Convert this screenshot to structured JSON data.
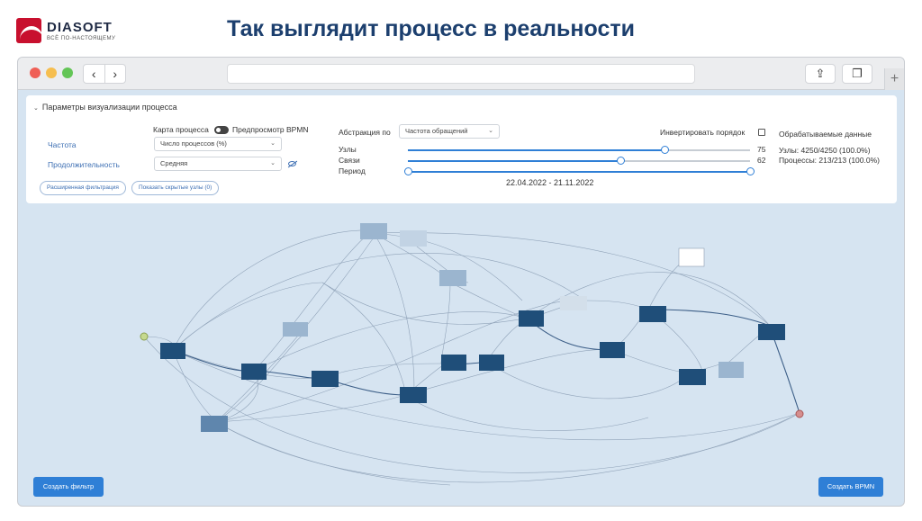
{
  "logo": {
    "name": "DIASOFT",
    "tagline": "ВСЁ ПО-НАСТОЯЩЕМУ"
  },
  "slide_title": "Так выглядит процесс в реальности",
  "browser": {
    "back_icon": "chevron-left-icon",
    "forward_icon": "chevron-right-icon",
    "share_icon": "share-icon",
    "tabs_icon": "tabs-icon",
    "new_tab_icon": "plus-icon"
  },
  "panel": {
    "title": "Параметры визуализации процесса",
    "map_label": "Карта процесса",
    "bpmn_preview_label": "Предпросмотр BPMN",
    "frequency_label": "Частота",
    "frequency_value": "Число процессов (%)",
    "duration_label": "Продолжительность",
    "duration_value": "Средняя",
    "extended_filter": "Расширенная фильтрация",
    "show_hidden_nodes": "Показать скрытые узлы (0)",
    "abstraction_label": "Абстракция по",
    "abstraction_value": "Частота обращений",
    "invert_order": "Инвертировать порядок",
    "nodes_label": "Узлы",
    "nodes_value": "75",
    "nodes_level": 0.75,
    "links_label": "Связи",
    "links_value": "62",
    "links_level": 0.62,
    "period_label": "Период",
    "period_range": "22.04.2022 - 21.11.2022",
    "processed_title": "Обрабатываемые данные",
    "processed_nodes": "Узлы: 4250/4250 (100.0%)",
    "processed_processes": "Процессы: 213/213 (100.0%)"
  },
  "buttons": {
    "create_filter": "Создать фильтр",
    "create_bpmn": "Создать BPMN"
  },
  "colors": {
    "accent": "#2f7fd6",
    "title": "#1c3f6e",
    "node_dark": "#1f4e79",
    "node_mid": "#5f86ad",
    "node_light": "#9bb5cf",
    "canvas": "#d6e4f1"
  }
}
